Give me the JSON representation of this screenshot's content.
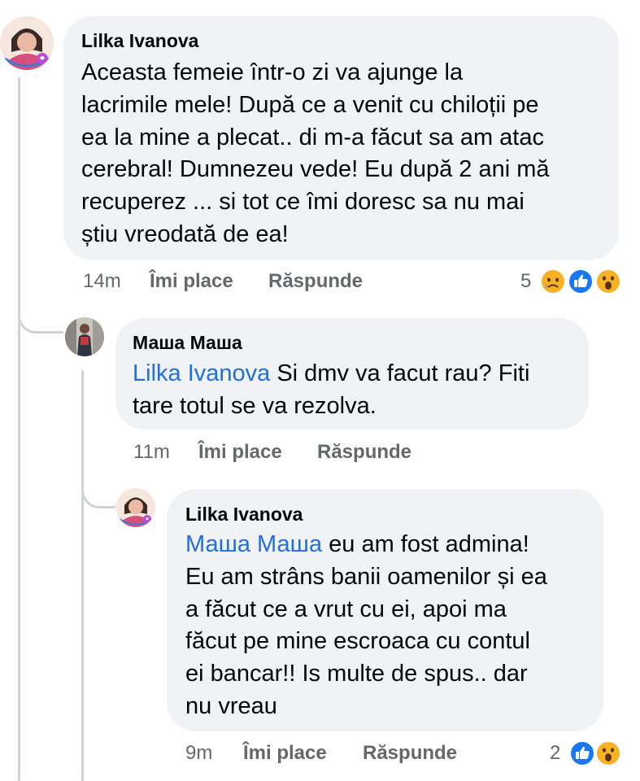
{
  "comments": [
    {
      "author": "Lilka Ivanova",
      "lines": [
        "Aceasta femeie într-o zi va ajunge la",
        "lacrimile mele! După ce a venit cu chiloții pe",
        "ea la mine a plecat.. di m-a făcut sa am atac",
        "cerebral! Dumnezeu vede! Eu după 2 ani mă",
        "recuperez ... si tot ce îmi doresc sa nu mai",
        "știu vreodată de ea!"
      ],
      "time": "14m",
      "like_label": "Îmi place",
      "reply_label": "Răspunde",
      "reaction_count": "5",
      "reactions": [
        "sad-icon",
        "like-icon",
        "wow-icon"
      ]
    },
    {
      "author": "Маша  Маша",
      "mention": "Lilka Ivanova",
      "lines": [
        " Si dmv va facut rau? Fiti",
        "tare totul se va rezolva."
      ],
      "time": "11m",
      "like_label": "Îmi place",
      "reply_label": "Răspunde"
    },
    {
      "author": "Lilka Ivanova",
      "mention": "Маша  Маша",
      "lines": [
        " eu am fost admina!",
        "Eu am strâns banii oamenilor și ea",
        "a făcut ce a vrut cu ei, apoi ma",
        "făcut pe mine escroaca cu contul",
        "ei bancar!! Is multe de spus..  dar",
        "nu vreau"
      ],
      "time": "9m",
      "like_label": "Îmi place",
      "reply_label": "Răspunde",
      "reaction_count": "2",
      "reactions": [
        "like-icon",
        "wow-icon"
      ]
    }
  ]
}
